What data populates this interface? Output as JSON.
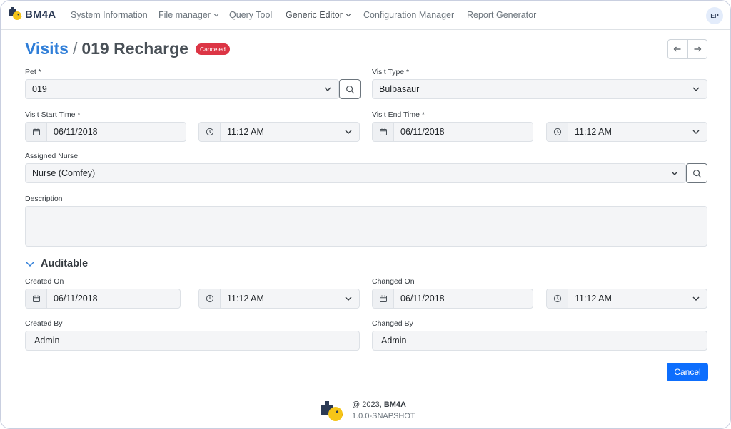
{
  "app": {
    "name": "BM4A",
    "user_initials": "EP"
  },
  "nav": [
    {
      "label": "System Information",
      "dropdown": false
    },
    {
      "label": "File manager",
      "dropdown": true
    },
    {
      "label": "Query Tool",
      "dropdown": false
    },
    {
      "label": "Generic Editor",
      "dropdown": true
    },
    {
      "label": "Configuration Manager",
      "dropdown": false
    },
    {
      "label": "Report Generator",
      "dropdown": false
    }
  ],
  "header": {
    "breadcrumb_link": "Visits",
    "separator": "/",
    "record_name": "019 Recharge",
    "status_badge": "Canceled",
    "prev_icon": "arrow-left-icon",
    "next_icon": "arrow-right-icon"
  },
  "form": {
    "pet": {
      "label": "Pet *",
      "value": "019"
    },
    "visit_type": {
      "label": "Visit Type *",
      "value": "Bulbasaur"
    },
    "visit_start": {
      "label": "Visit Start Time *",
      "date": "06/11/2018",
      "time": "11:12 AM"
    },
    "visit_end": {
      "label": "Visit End Time *",
      "date": "06/11/2018",
      "time": "11:12 AM"
    },
    "assigned_nurse": {
      "label": "Assigned Nurse",
      "value": "Nurse (Comfey)"
    },
    "description": {
      "label": "Description",
      "value": ""
    }
  },
  "auditable": {
    "title": "Auditable",
    "created_on": {
      "label": "Created On",
      "date": "06/11/2018",
      "time": "11:12 AM"
    },
    "changed_on": {
      "label": "Changed On",
      "date": "06/11/2018",
      "time": "11:12 AM"
    },
    "created_by": {
      "label": "Created By",
      "value": "Admin"
    },
    "changed_by": {
      "label": "Changed By",
      "value": "Admin"
    }
  },
  "actions": {
    "cancel_label": "Cancel"
  },
  "footer": {
    "copyright_prefix": "@ 2023,",
    "brand_link": "BM4A",
    "version": "1.0.0-SNAPSHOT"
  },
  "colors": {
    "primary": "#0d6efd",
    "link": "#2f7ed8",
    "danger": "#dc3545",
    "brand": "#2b3a55",
    "logo_yellow": "#f5c518"
  }
}
